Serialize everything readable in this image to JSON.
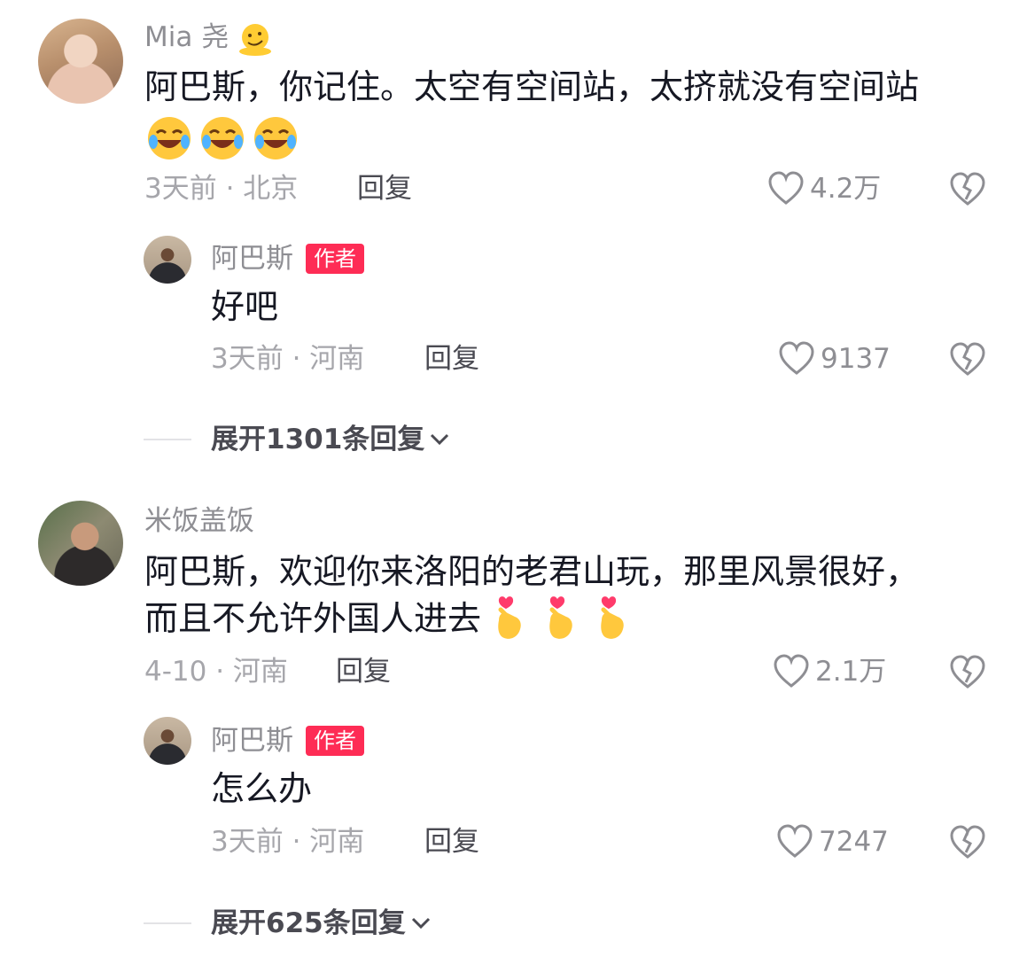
{
  "comments": [
    {
      "username": "Mia 尧",
      "text_line1": "阿巴斯，你记住。太空有空间站，太挤就没有空间站",
      "emoji_name_icon": "melting-face-icon",
      "emoji_text_icon": "rolling-laughing-face-icon",
      "meta": "3天前 · 北京",
      "reply": "回复",
      "likes": "4.2万",
      "reply_comment": {
        "username": "阿巴斯",
        "badge": "作者",
        "text": "好吧",
        "meta": "3天前 · 河南",
        "reply": "回复",
        "likes": "9137"
      },
      "expand": "展开1301条回复"
    },
    {
      "username": "米饭盖饭",
      "text_line1": "阿巴斯，欢迎你来洛阳的老君山玩，那里风景很好，",
      "text_line2": "而且不允许外国人进去",
      "emoji_text_icon": "finger-heart-icon",
      "meta": "4-10 · 河南",
      "reply": "回复",
      "likes": "2.1万",
      "reply_comment": {
        "username": "阿巴斯",
        "badge": "作者",
        "text": "怎么办",
        "meta": "3天前 · 河南",
        "reply": "回复",
        "likes": "7247"
      },
      "expand": "展开625条回复"
    }
  ],
  "colors": {
    "badge": "#fe2c55",
    "text": "#161823",
    "secondary": "#8e8e93"
  }
}
